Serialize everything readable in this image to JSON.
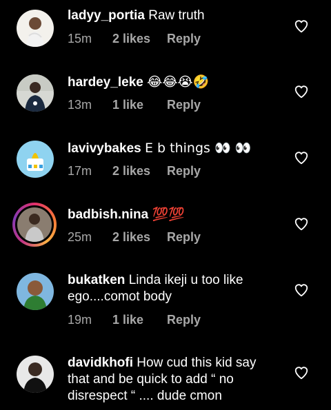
{
  "comments": [
    {
      "username": "ladyy_portia",
      "text": "Raw truth",
      "time": "15m",
      "likes": "2 likes",
      "reply": "Reply"
    },
    {
      "username": "hardey_leke",
      "text": "😂😂😭🤣",
      "time": "13m",
      "likes": "1 like",
      "reply": "Reply"
    },
    {
      "username": "lavivybakes",
      "text": "E b things 👀 👀",
      "time": "17m",
      "likes": "2 likes",
      "reply": "Reply"
    },
    {
      "username": "badbish.nina",
      "text": "💯💯",
      "time": "25m",
      "likes": "2 likes",
      "reply": "Reply"
    },
    {
      "username": "bukatken",
      "text": "Linda ikeji u too like ego....comot body",
      "time": "19m",
      "likes": "1 like",
      "reply": "Reply"
    },
    {
      "username": "davidkhofi",
      "text": "How cud this kid say that and be quick to add “ no disrespect “ .... dude cmon",
      "time": "",
      "likes": "",
      "reply": ""
    }
  ],
  "icons": {
    "like": "heart-outline-icon"
  },
  "colors": {
    "background": "#000000",
    "text": "#ffffff",
    "meta": "#a8a8a8",
    "story_ring": "#e1306c"
  }
}
